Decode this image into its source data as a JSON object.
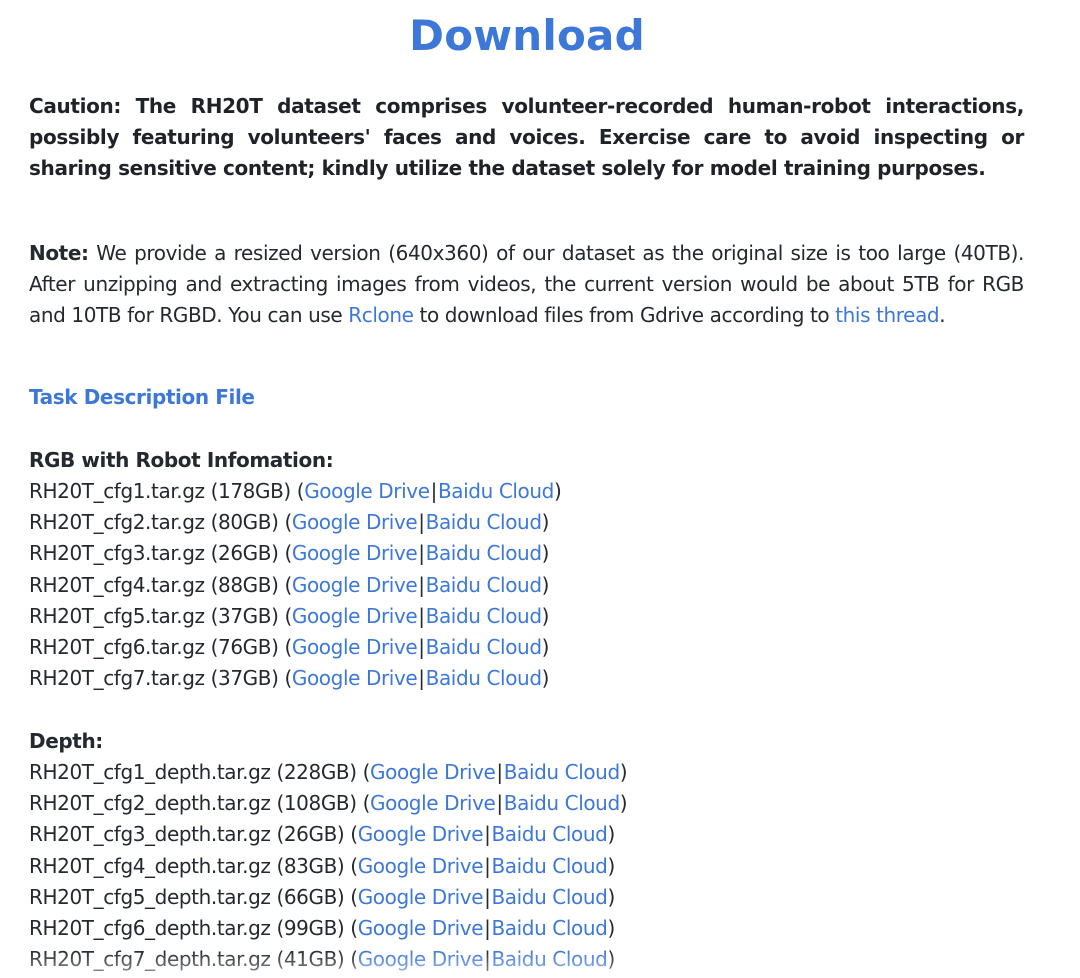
{
  "title": "Download",
  "caution": "Caution: The RH20T dataset comprises volunteer-recorded human-robot interactions, possibly featuring volunteers' faces and voices. Exercise care to avoid inspecting or sharing sensitive content; kindly utilize the dataset solely for model training purposes.",
  "note": {
    "label": "Note:",
    "text_1": " We provide a resized version (640x360) of our dataset as the original size is too large (40TB). After unzipping and extracting images from videos, the current version would be about 5TB for RGB and 10TB for RGBD. You can use ",
    "rclone_link": "Rclone",
    "text_2": " to download files from Gdrive according to ",
    "thread_link": "this thread",
    "text_3": "."
  },
  "task_description_link": "Task Description File",
  "rgb_section": {
    "heading": "RGB with Robot Infomation:",
    "files": [
      {
        "name": "RH20T_cfg1.tar.gz",
        "size": "(178GB)"
      },
      {
        "name": "RH20T_cfg2.tar.gz",
        "size": "(80GB)"
      },
      {
        "name": "RH20T_cfg3.tar.gz",
        "size": "(26GB)"
      },
      {
        "name": "RH20T_cfg4.tar.gz",
        "size": "(88GB)"
      },
      {
        "name": "RH20T_cfg5.tar.gz",
        "size": "(37GB)"
      },
      {
        "name": "RH20T_cfg6.tar.gz",
        "size": "(76GB)"
      },
      {
        "name": "RH20T_cfg7.tar.gz",
        "size": "(37GB)"
      }
    ]
  },
  "depth_section": {
    "heading": "Depth:",
    "files": [
      {
        "name": "RH20T_cfg1_depth.tar.gz",
        "size": "(228GB)"
      },
      {
        "name": "RH20T_cfg2_depth.tar.gz",
        "size": "(108GB)"
      },
      {
        "name": "RH20T_cfg3_depth.tar.gz",
        "size": "(26GB)"
      },
      {
        "name": "RH20T_cfg4_depth.tar.gz",
        "size": "(83GB)"
      },
      {
        "name": "RH20T_cfg5_depth.tar.gz",
        "size": "(66GB)"
      },
      {
        "name": "RH20T_cfg6_depth.tar.gz",
        "size": "(99GB)"
      },
      {
        "name": "RH20T_cfg7_depth.tar.gz",
        "size": "(41GB)"
      }
    ]
  },
  "link_labels": {
    "google_drive": "Google Drive",
    "baidu_cloud": "Baidu Cloud",
    "separator": "|",
    "open_paren": "(",
    "close_paren": ")"
  },
  "colors": {
    "link": "#3d78d8",
    "text": "#24292f",
    "background": "#ffffff"
  }
}
